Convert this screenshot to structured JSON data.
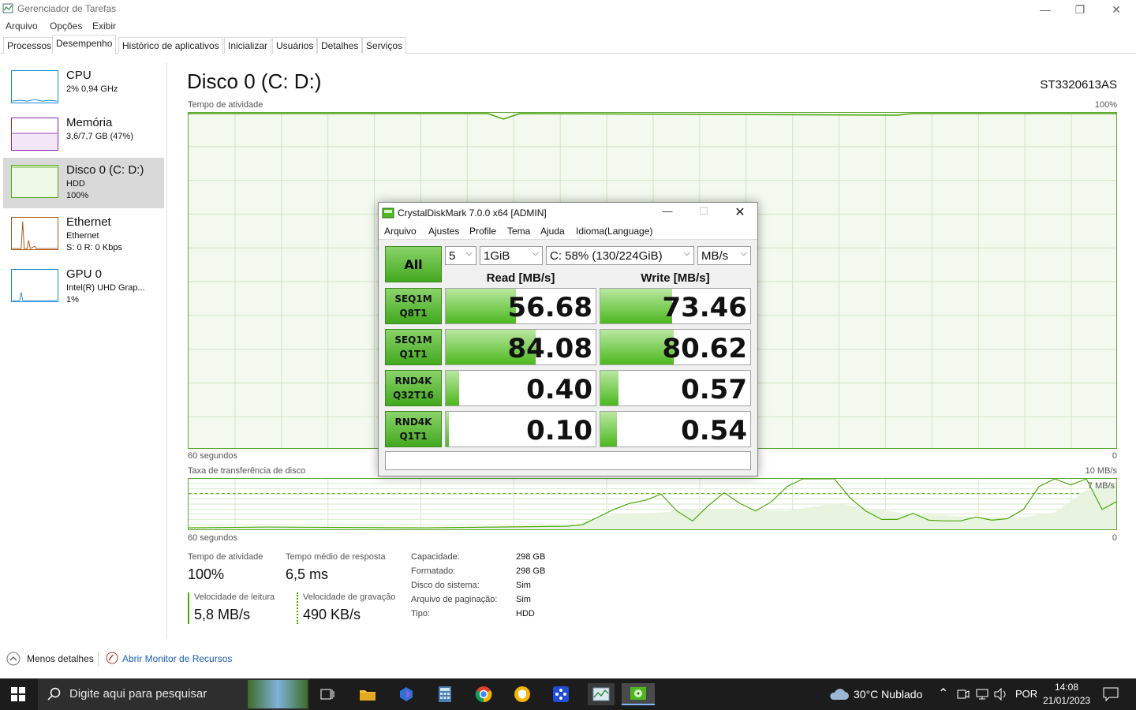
{
  "window": {
    "title": "Gerenciador de Tarefas"
  },
  "menu": [
    "Arquivo",
    "Opções",
    "Exibir"
  ],
  "tabs": [
    "Processos",
    "Desempenho",
    "Histórico de aplicativos",
    "Inicializar",
    "Usuários",
    "Detalhes",
    "Serviços"
  ],
  "sidebar": [
    {
      "title": "CPU",
      "line1": "2% 0,94 GHz",
      "line2": "",
      "line3": ""
    },
    {
      "title": "Memória",
      "line1": "3,6/7,7 GB (47%)",
      "line2": "",
      "line3": ""
    },
    {
      "title": "Disco 0 (C: D:)",
      "line1": "HDD",
      "line2": "100%",
      "line3": ""
    },
    {
      "title": "Ethernet",
      "line1": "Ethernet",
      "line2": "S: 0 R: 0 Kbps",
      "line3": ""
    },
    {
      "title": "GPU 0",
      "line1": "Intel(R) UHD Grap...",
      "line2": "1%",
      "line3": ""
    }
  ],
  "main": {
    "heading": "Disco 0 (C: D:)",
    "model": "ST3320613AS",
    "activity_label": "Tempo de atividade",
    "activity_max": "100%",
    "activity_time": "60 segundos",
    "activity_min": "0",
    "transfer_label": "Taxa de transferência de disco",
    "transfer_max": "10 MB/s",
    "transfer_marker": "7 MB/s",
    "transfer_time": "60 segundos",
    "transfer_min": "0"
  },
  "stats": {
    "activity_label": "Tempo de atividade",
    "activity_value": "100%",
    "response_label": "Tempo médio de resposta",
    "response_value": "6,5 ms",
    "read_label": "Velocidade de leitura",
    "read_value": "5,8 MB/s",
    "write_label": "Velocidade de gravação",
    "write_value": "490 KB/s"
  },
  "details": [
    {
      "label": "Capacidade:",
      "value": "298 GB"
    },
    {
      "label": "Formatado:",
      "value": "298 GB"
    },
    {
      "label": "Disco do sistema:",
      "value": "Sim"
    },
    {
      "label": "Arquivo de paginação:",
      "value": "Sim"
    },
    {
      "label": "Tipo:",
      "value": "HDD"
    }
  ],
  "footer": {
    "less_details": "Menos detalhes",
    "resource_monitor": "Abrir Monitor de Recursos"
  },
  "cdm": {
    "title": "CrystalDiskMark 7.0.0 x64 [ADMIN]",
    "menu": [
      "Arquivo",
      "Ajustes",
      "Profile",
      "Tema",
      "Ajuda",
      "Idioma(Language)"
    ],
    "all_label": "All",
    "count": "5",
    "size": "1GiB",
    "drive": "C: 58% (130/224GiB)",
    "unit": "MB/s",
    "read_header": "Read [MB/s]",
    "write_header": "Write [MB/s]",
    "rows": [
      {
        "l1": "SEQ1M",
        "l2": "Q8T1",
        "read": "56.68",
        "write": "73.46",
        "read_fill": 0.47,
        "write_fill": 0.48
      },
      {
        "l1": "SEQ1M",
        "l2": "Q1T1",
        "read": "84.08",
        "write": "80.62",
        "read_fill": 0.6,
        "write_fill": 0.49
      },
      {
        "l1": "RND4K",
        "l2": "Q32T16",
        "read": "0.40",
        "write": "0.57",
        "read_fill": 0.09,
        "write_fill": 0.12
      },
      {
        "l1": "RND4K",
        "l2": "Q1T1",
        "read": "0.10",
        "write": "0.54",
        "read_fill": 0.02,
        "write_fill": 0.11
      }
    ]
  },
  "taskbar": {
    "search_placeholder": "Digite aqui para pesquisar",
    "weather": "30°C  Nublado",
    "language": "POR",
    "time": "14:08",
    "date": "21/01/2023"
  },
  "colors": {
    "accent": "#4da60c",
    "cdm_green": "#42a81e",
    "disk_chart": "#5ea838"
  }
}
